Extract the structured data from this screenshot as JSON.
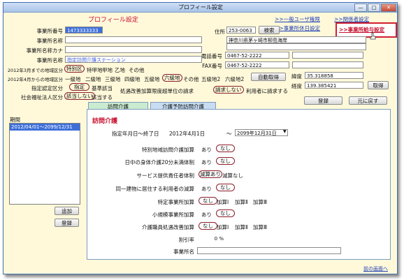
{
  "window": {
    "title": "プロフィール設定",
    "minimize": "—",
    "maximize": "□",
    "close": "✕"
  },
  "header": {
    "heading": "プロフィール設定"
  },
  "links": {
    "general_user": ">>一般ユーザ権限",
    "office_holidays": ">>事業所休日設定",
    "related_settings": ">>関係者設定",
    "office_fees": ">>事業所給与設定"
  },
  "form": {
    "office_number": {
      "label": "事業所番号",
      "value": "1473333333"
    },
    "office_name": {
      "label": "事業所名称",
      "value": ""
    },
    "office_kana": {
      "label": "事業所名称カナ",
      "value": ""
    },
    "office_abbr": {
      "label": "事業所名称",
      "value": "指定訪問介護ステーション"
    },
    "region_2012": {
      "label": "2012年3月までの地域区分",
      "options": [
        "特別区",
        "特甲地",
        "甲地",
        "乙地",
        "その他"
      ]
    },
    "region_2012b": {
      "label": "2012年4月からの地域区分",
      "options": [
        "一級地",
        "二級地",
        "三級地",
        "四級地",
        "五級地",
        "六級地",
        "その他",
        "五級地2",
        "六級地2"
      ]
    },
    "designation": {
      "label": "指定認定区分",
      "options": [
        "指定",
        "基準該当"
      ]
    },
    "social_welfare": {
      "label": "社会福祉法人区分",
      "options": [
        "該当しない",
        "該当する"
      ]
    },
    "address": {
      "label": "住所",
      "postal": "253-0063",
      "search": "検索",
      "line1": "神奈川県茅ヶ崎市柳島海岸",
      "line2": ""
    },
    "phone": {
      "label": "電話番号",
      "value": "0467-52-2222"
    },
    "fax": {
      "label": "FAX番号",
      "value": "0467-52-2222"
    },
    "auto_fetch": "自動取得",
    "latitude": {
      "label": "緯度",
      "value": "35.318858"
    },
    "longitude": {
      "label": "経度",
      "value": "139.385421"
    },
    "get_btn": "取得",
    "improve": {
      "label": "処遇改善加算限度超単位の請求",
      "options": [
        "請求しない",
        "利用者に請求する"
      ]
    },
    "register": "登録",
    "back": "元に戻す"
  },
  "left": {
    "period_label": "期間",
    "period_item": "2012/04/01～2099/12/31",
    "add": "追加",
    "register": "登録"
  },
  "tabs": [
    "訪問介護",
    "介護予防訪問介護"
  ],
  "panel": {
    "title": "訪問介護",
    "date_label": "指定年月日～終了日",
    "start_date": "2012年4月1日",
    "sep": "～",
    "end_date": "2099年12月31日",
    "rows": [
      {
        "label": "特別地域訪問介護加算",
        "options": [
          "あり",
          "なし"
        ]
      },
      {
        "label": "日中の身体介護20分未満体制",
        "options": [
          "あり",
          "なし"
        ]
      },
      {
        "label": "サービス提供責任者体制",
        "options": [
          "減算あり",
          "減算なし"
        ]
      },
      {
        "label": "同一建物に居住する利用者の減算",
        "options": [
          "あり",
          "なし"
        ]
      },
      {
        "label": "特定事業所加算",
        "options": [
          "なし",
          "加算Ⅰ",
          "加算Ⅱ",
          "加算Ⅲ"
        ]
      },
      {
        "label": "小規模事業所加算",
        "options": [
          "あり",
          "なし"
        ]
      },
      {
        "label": "介護職員処遇改善加算",
        "options": [
          "なし",
          "加算Ⅰ",
          "加算Ⅱ",
          "加算Ⅲ"
        ]
      }
    ],
    "discount_label": "割引率",
    "discount_value": "0 %",
    "office_name_label": "事業所名"
  },
  "footer": {
    "prev": "前の画面へ"
  }
}
